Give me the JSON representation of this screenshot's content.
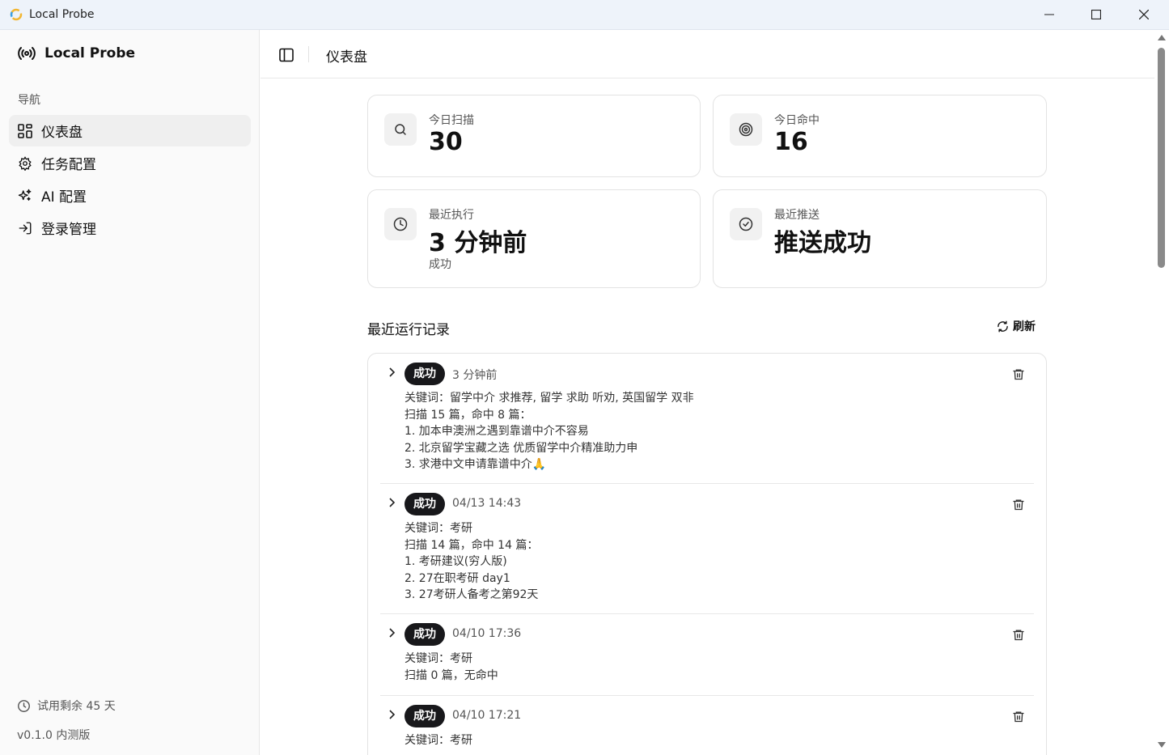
{
  "window": {
    "title": "Local Probe"
  },
  "sidebar": {
    "brand": "Local Probe",
    "nav_heading": "导航",
    "items": [
      {
        "label": "仪表盘",
        "icon": "dashboard-icon",
        "active": true
      },
      {
        "label": "任务配置",
        "icon": "gear-icon",
        "active": false
      },
      {
        "label": "AI 配置",
        "icon": "sparkles-icon",
        "active": false
      },
      {
        "label": "登录管理",
        "icon": "login-icon",
        "active": false
      }
    ],
    "trial": "试用剩余 45 天",
    "version": "v0.1.0 内测版"
  },
  "header": {
    "title": "仪表盘"
  },
  "stats": [
    {
      "label": "今日扫描",
      "value": "30",
      "icon": "search-icon"
    },
    {
      "label": "今日命中",
      "value": "16",
      "icon": "target-icon"
    },
    {
      "label": "最近执行",
      "value": "3 分钟前",
      "sub": "成功",
      "icon": "clock-icon"
    },
    {
      "label": "最近推送",
      "value": "推送成功",
      "icon": "check-circle-icon"
    }
  ],
  "runs": {
    "title": "最近运行记录",
    "refresh_label": "刷新",
    "items": [
      {
        "status": "成功",
        "time": "3 分钟前",
        "lines": [
          "关键词：留学中介 求推荐, 留学 求助 听劝, 英国留学 双非",
          "扫描 15 篇，命中 8 篇：",
          "1. 加本申澳洲之遇到靠谱中介不容易",
          "2. 北京留学宝藏之选 优质留学中介精准助力申",
          "3. 求港中文申请靠谱中介🙏"
        ]
      },
      {
        "status": "成功",
        "time": "04/13 14:43",
        "lines": [
          "关键词：考研",
          "扫描 14 篇，命中 14 篇：",
          "1. 考研建议(穷人版)",
          "2. 27在职考研 day1",
          "3. 27考研人备考之第92天"
        ]
      },
      {
        "status": "成功",
        "time": "04/10 17:36",
        "lines": [
          "关键词：考研",
          "扫描 0 篇，无命中"
        ]
      },
      {
        "status": "成功",
        "time": "04/10 17:21",
        "lines": [
          "关键词：考研"
        ]
      }
    ]
  }
}
